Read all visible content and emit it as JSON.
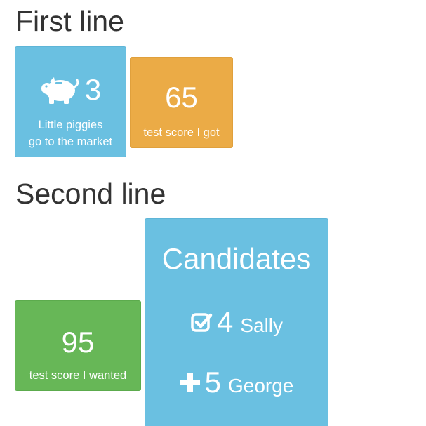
{
  "sections": {
    "first_title": "First line",
    "second_title": "Second line"
  },
  "first_line": {
    "piggies": {
      "value": "3",
      "caption_line1": "Little piggies",
      "caption_line2": "go to the market",
      "icon": "piggy-bank-icon",
      "color": "#6ac0e1"
    },
    "score_got": {
      "value": "65",
      "caption": "test score I got",
      "color": "#ebab46"
    }
  },
  "second_line": {
    "score_wanted": {
      "value": "95",
      "caption": "test score I wanted",
      "color": "#67b757"
    },
    "candidates": {
      "title": "Candidates",
      "color": "#6ac0e1",
      "rows": [
        {
          "icon": "check-square-icon",
          "count": "4",
          "name": "Sally"
        },
        {
          "icon": "plus-icon",
          "count": "5",
          "name": "George"
        }
      ]
    }
  }
}
